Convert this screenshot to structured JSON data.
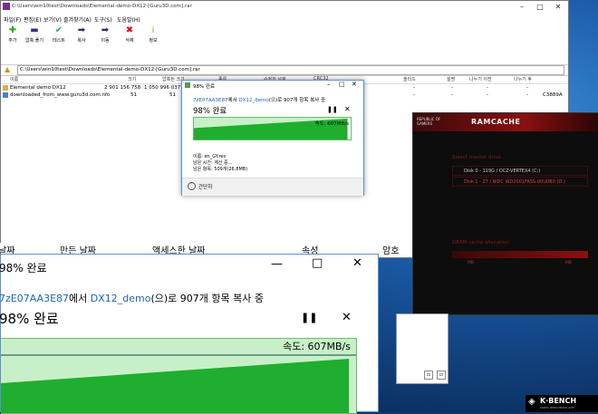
{
  "winrar": {
    "title": "C:\\Users\\win10test\\Downloads\\Elemental-demo-DX12-[Guru3D.com].rar",
    "menu": [
      "파일(F)",
      "편집(E)",
      "보기(V)",
      "즐겨찾기(A)",
      "도구(S)",
      "도움말(H)"
    ],
    "toolbar": [
      "추가",
      "압축 풀기",
      "테스트",
      "복사",
      "이동",
      "삭제",
      "정보"
    ],
    "address": "C:\\Users\\win10test\\Downloads\\Elemental-demo-DX12-[Guru3D.com].rar",
    "columns": [
      "이름",
      "크기",
      "압축된 크기",
      "종류",
      "수정한 날짜",
      "CRC32",
      "솔리드",
      "설명",
      "나누기 이전",
      "나누기 후"
    ],
    "files": [
      {
        "name": "Elemental demo DX12",
        "size": "2 901 156 758",
        "packed": "1 050 996 037",
        "crc": ""
      },
      {
        "name": "downloaded_from_www.guru3d.com.nfo",
        "size": "51",
        "packed": "51",
        "crc": "C3889A"
      }
    ],
    "row_dash": "-"
  },
  "small_dialog": {
    "header": "98% 완료",
    "sub_src": "7zE07AA3E87",
    "sub_mid": "에서 ",
    "sub_dst": "DX12_demo",
    "sub_end": "(으)로 907개 항목 복사 중",
    "percent": "98% 완료",
    "speed": "속도: 607MB/s",
    "name_line": "이름: en_GY.res",
    "time_line": "남은 시간: 계산 중...",
    "items_line": "남은 항목: 509개(26.8MB)",
    "less": "간단히",
    "progress": 0.98
  },
  "ramcache": {
    "brand_line1": "REPUBLIC OF",
    "brand_line2": "GAMERS",
    "title": "RAMCACHE",
    "select_label": "Select master drive",
    "disk0": "Disk 0 - 119G / OCZ-VERTEX4 (C:)",
    "disk1": "Disk 1 - 2T / WDC WD2001FASS-00U0B0 (D:)",
    "alloc_label": "DRAM cache allocation",
    "slider_left": "MB",
    "slider_right": "MB"
  },
  "strip": {
    "c1": "날짜",
    "c2": "만든 날짜",
    "c3": "액세스한 날짜",
    "c4": "속성",
    "c5": "암호"
  },
  "big_dialog": {
    "title": "98% 완료",
    "sub_src": "7zE07AA3E87",
    "sub_mid": "에서 ",
    "sub_dst": "DX12_demo",
    "sub_end": "(으)로 907개 항목 복사 중",
    "percent": "98% 완료",
    "speed": "속도: 607MB/s",
    "progress": 0.98
  },
  "watermark": "K·BENCH",
  "watermark_sub": "KOREA BENCHMARK SITE",
  "colors": {
    "progress_fill": "#1fae2f",
    "progress_light": "#c8f0c8",
    "ram_red": "#8a1010",
    "link_blue": "#1f63b4"
  }
}
